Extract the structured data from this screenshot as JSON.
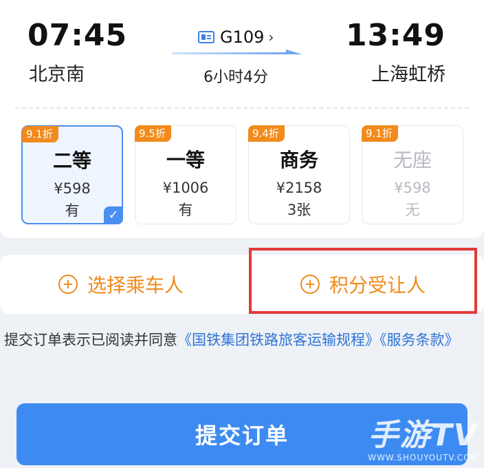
{
  "trip": {
    "departure_time": "07:45",
    "departure_station": "北京南",
    "arrival_time": "13:49",
    "arrival_station": "上海虹桥",
    "train_number": "G109",
    "duration": "6小时4分"
  },
  "seats": [
    {
      "discount": "9.1折",
      "class": "二等",
      "price": "¥598",
      "availability": "有"
    },
    {
      "discount": "9.5折",
      "class": "一等",
      "price": "¥1006",
      "availability": "有"
    },
    {
      "discount": "9.4折",
      "class": "商务",
      "price": "¥2158",
      "availability": "3张"
    },
    {
      "discount": "9.1折",
      "class": "无座",
      "price": "¥598",
      "availability": "无"
    }
  ],
  "actions": {
    "select_passenger": "选择乘车人",
    "points_transferee": "积分受让人"
  },
  "agreement": {
    "text": "提交订单表示已阅读并同意",
    "link1": "《国铁集团铁路旅客运输规程》",
    "link2": "《服务条款》"
  },
  "submit_label": "提交订单",
  "watermark": {
    "main": "手游TV",
    "sub": "WWW.SHOUYOUTV.COM"
  },
  "colors": {
    "accent": "#3d8bf2",
    "orange": "#f08a1d",
    "highlight": "#e23a3a"
  }
}
